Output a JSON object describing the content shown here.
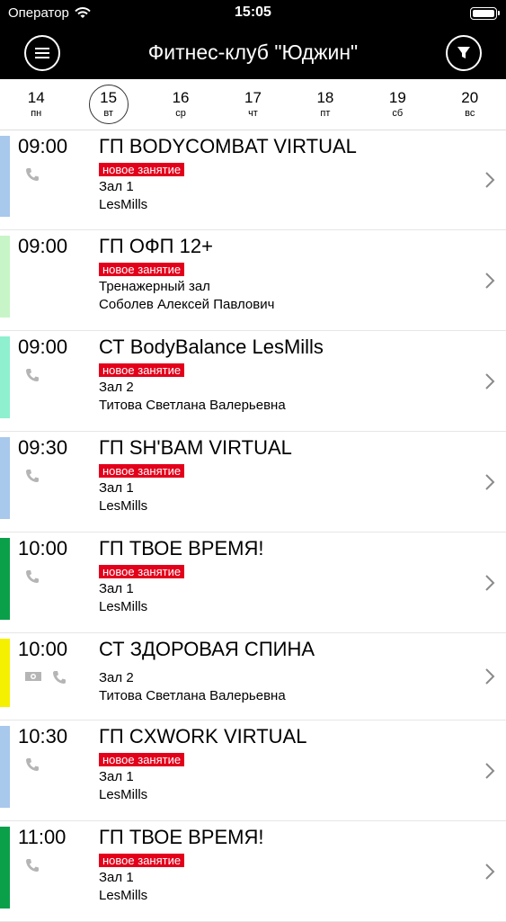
{
  "status_bar": {
    "carrier": "Оператор",
    "time": "15:05"
  },
  "header": {
    "title": "Фитнес-клуб \"Юджин\""
  },
  "colors": {
    "badge": "#e3001b"
  },
  "days": [
    {
      "num": "14",
      "wd": "пн",
      "selected": false
    },
    {
      "num": "15",
      "wd": "вт",
      "selected": true
    },
    {
      "num": "16",
      "wd": "ср",
      "selected": false
    },
    {
      "num": "17",
      "wd": "чт",
      "selected": false
    },
    {
      "num": "18",
      "wd": "пт",
      "selected": false
    },
    {
      "num": "19",
      "wd": "сб",
      "selected": false
    },
    {
      "num": "20",
      "wd": "вс",
      "selected": false
    }
  ],
  "sessions": [
    {
      "time": "09:00",
      "title": "ГП BODYCOMBAT VIRTUAL",
      "badge": "новое занятие",
      "hall": "Зал 1",
      "trainer": "LesMills",
      "color": "#a8c8ec",
      "icons": [
        "phone-icon"
      ]
    },
    {
      "time": "09:00",
      "title": "ГП ОФП 12+",
      "badge": "новое занятие",
      "hall": "Тренажерный зал",
      "trainer": "Соболев Алексей Павлович",
      "color": "#c8f5c8",
      "icons": []
    },
    {
      "time": "09:00",
      "title": "СТ BodyBalance LesMills",
      "badge": "новое занятие",
      "hall": "Зал 2",
      "trainer": "Титова Светлана Валерьевна",
      "color": "#8ef0cf",
      "icons": [
        "phone-icon"
      ]
    },
    {
      "time": "09:30",
      "title": "ГП SH'BAM VIRTUAL",
      "badge": "новое занятие",
      "hall": "Зал 1",
      "trainer": "LesMills",
      "color": "#a8c8ec",
      "icons": [
        "phone-icon"
      ]
    },
    {
      "time": "10:00",
      "title": "ГП ТВОЕ ВРЕМЯ!",
      "badge": "новое занятие",
      "hall": "Зал 1",
      "trainer": "LesMills",
      "color": "#0aa04a",
      "icons": [
        "phone-icon"
      ]
    },
    {
      "time": "10:00",
      "title": "СТ ЗДОРОВАЯ СПИНА",
      "badge": "",
      "hall": "Зал 2",
      "trainer": "Титова Светлана Валерьевна",
      "color": "#f5f000",
      "icons": [
        "money-icon",
        "phone-icon"
      ]
    },
    {
      "time": "10:30",
      "title": "ГП CXWORK VIRTUAL",
      "badge": "новое занятие",
      "hall": "Зал 1",
      "trainer": "LesMills",
      "color": "#a8c8ec",
      "icons": [
        "phone-icon"
      ]
    },
    {
      "time": "11:00",
      "title": "ГП ТВОЕ ВРЕМЯ!",
      "badge": "новое занятие",
      "hall": "Зал 1",
      "trainer": "LesMills",
      "color": "#0aa04a",
      "icons": [
        "phone-icon"
      ]
    }
  ]
}
